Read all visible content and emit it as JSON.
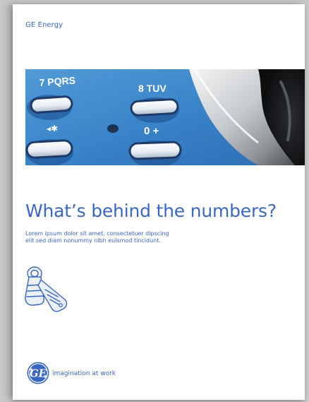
{
  "document": {
    "brand": "GE Energy",
    "headline": "What’s behind the numbers?",
    "body_line_1": "Lorem ipsum dolor sit amet, consectetuer dipscing",
    "body_line_2": "elit sed diam nonummy nibh euismod tincidunt.",
    "logo_text": "GE",
    "tagline": "imagination at work"
  },
  "hero": {
    "keys": [
      {
        "label": "7 PQRS"
      },
      {
        "label": "8 TUV"
      },
      {
        "label": "◂✱"
      },
      {
        "label": "0 +"
      }
    ]
  },
  "colors": {
    "brand_blue": "#3a67c2",
    "page": "#ffffff",
    "background": "#c9c9c9"
  },
  "icons": [
    "flip-phone-icon",
    "ge-logo-icon"
  ]
}
